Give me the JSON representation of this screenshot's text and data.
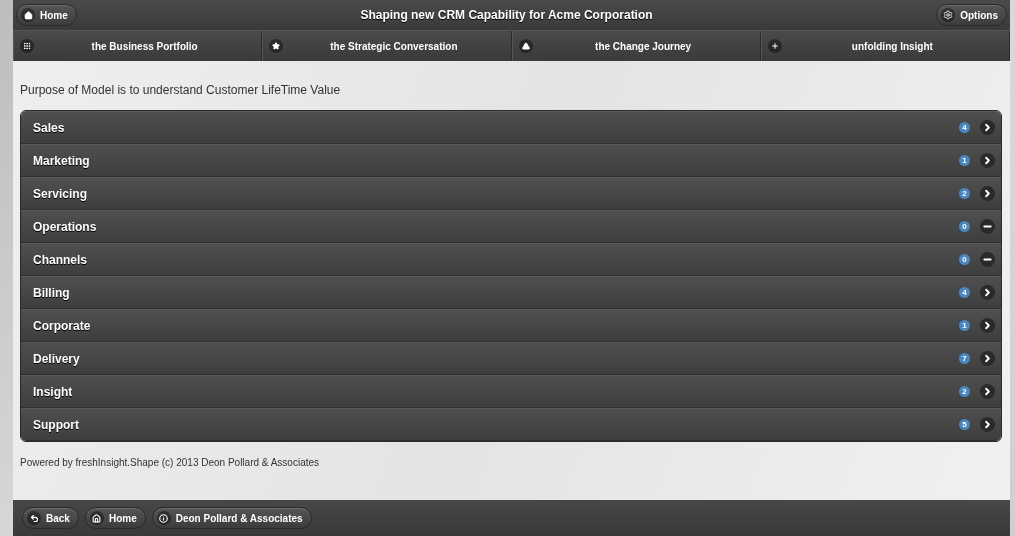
{
  "header": {
    "home_button": "Home",
    "title": "Shaping new CRM Capability for Acme Corporation",
    "options_button": "Options"
  },
  "navbar": [
    {
      "label": "the Business Portfolio",
      "kind": "grid"
    },
    {
      "label": "the Strategic Conversation",
      "kind": "star"
    },
    {
      "label": "the Change Journey",
      "kind": "alert"
    },
    {
      "label": "unfolding Insight",
      "kind": "plus"
    }
  ],
  "intro": "Purpose of Model is to understand Customer LifeTime Value",
  "list": [
    {
      "label": "Sales",
      "count": "4",
      "kind": "link"
    },
    {
      "label": "Marketing",
      "count": "1",
      "kind": "link"
    },
    {
      "label": "Servicing",
      "count": "2",
      "kind": "link"
    },
    {
      "label": "Operations",
      "count": "0",
      "kind": "empty"
    },
    {
      "label": "Channels",
      "count": "0",
      "kind": "empty"
    },
    {
      "label": "Billing",
      "count": "4",
      "kind": "link"
    },
    {
      "label": "Corporate",
      "count": "1",
      "kind": "link"
    },
    {
      "label": "Delivery",
      "count": "7",
      "kind": "link"
    },
    {
      "label": "Insight",
      "count": "2",
      "kind": "link"
    },
    {
      "label": "Support",
      "count": "5",
      "kind": "link"
    }
  ],
  "powered_by": "Powered by freshInsight.Shape (c) 2013 Deon Pollard & Associates",
  "footer_buttons": [
    {
      "label": "Back",
      "kind": "back"
    },
    {
      "label": "Home",
      "kind": "home"
    },
    {
      "label": "Deon Pollard & Associates",
      "kind": "info"
    }
  ]
}
